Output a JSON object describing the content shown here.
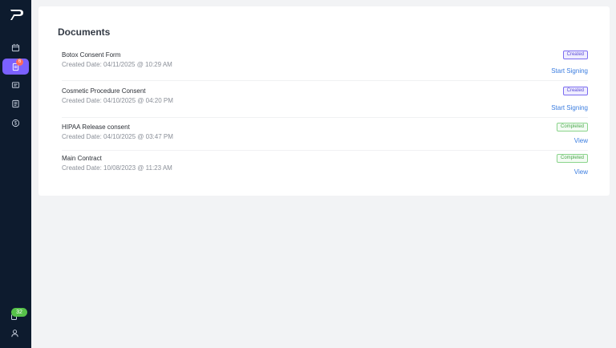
{
  "sidebar": {
    "documents_badge": "6",
    "credits": "32"
  },
  "main": {
    "title": "Documents",
    "documents": [
      {
        "name": "Botox Consent Form",
        "created": "Created Date: 04/11/2025 @ 10:29 AM",
        "status": "Created",
        "action": "Start Signing"
      },
      {
        "name": "Cosmetic Procedure Consent",
        "created": "Created Date: 04/10/2025 @ 04:20 PM",
        "status": "Created",
        "action": "Start Signing"
      },
      {
        "name": "HIPAA Release consent",
        "created": "Created Date: 04/10/2025 @ 03:47 PM",
        "status": "Completed",
        "action": "View"
      },
      {
        "name": "Main Contract",
        "created": "Created Date: 10/08/2023 @ 11:23 AM",
        "status": "Completed",
        "action": "View"
      }
    ]
  },
  "colors": {
    "sidebar_bg": "#0d1b2e",
    "active_nav": "#7b61ff",
    "link": "#3b7de0",
    "created_badge": "#7b6cf0",
    "completed_badge": "#8ad48b"
  },
  "icons": {
    "logo": "brand-logo",
    "nav": [
      "calendar-icon",
      "documents-icon",
      "messages-icon",
      "list-icon",
      "dollar-icon"
    ],
    "footer": [
      "credits-icon",
      "user-icon"
    ]
  }
}
